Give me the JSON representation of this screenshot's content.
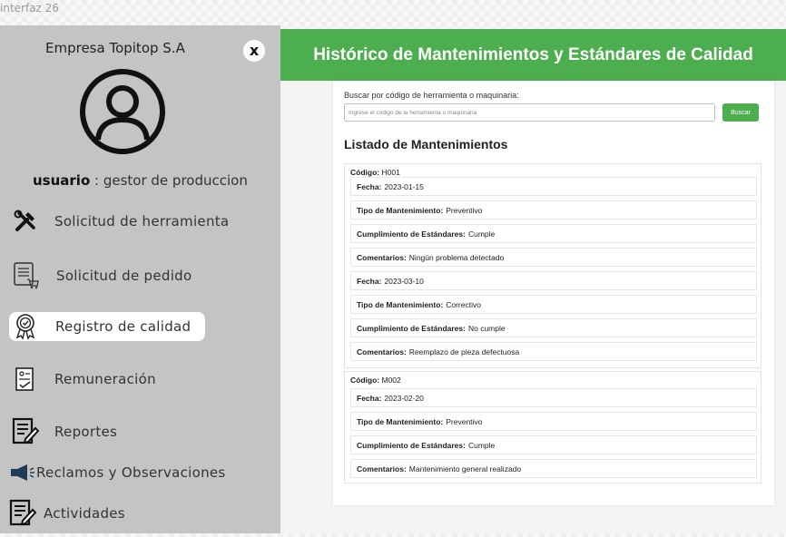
{
  "window": {
    "title": "interfaz 26"
  },
  "sidebar": {
    "company": "Empresa Topitop S.A",
    "close_label": "x",
    "user_label": "usuario",
    "user_role": " : gestor de produccion",
    "items": [
      {
        "label": "Solicitud de herramienta",
        "icon": "tools-icon"
      },
      {
        "label": "Solicitud de pedido",
        "icon": "order-list-cart-icon"
      },
      {
        "label": "Registro de calidad",
        "icon": "quality-badge-icon",
        "active": true
      },
      {
        "label": "Remuneración",
        "icon": "payroll-document-icon"
      },
      {
        "label": "Reportes",
        "icon": "report-edit-icon"
      },
      {
        "label": "Reclamos y Observaciones",
        "icon": "megaphone-icon"
      },
      {
        "label": "Actividades",
        "icon": "activities-edit-icon"
      }
    ]
  },
  "header": {
    "title": "Histórico de Mantenimientos y Estándares de Calidad"
  },
  "search": {
    "label": "Buscar por código de herramienta o maquinaria:",
    "placeholder": "Ingrese el código de la herramienta o maquinaria",
    "button": "Buscar"
  },
  "list": {
    "title": "Listado de Mantenimientos",
    "code_label": "Código:",
    "labels": {
      "fecha": "Fecha:",
      "tipo": "Tipo de Mantenimiento:",
      "cumplimiento": "Cumplimiento de Estándares:",
      "comentarios": "Comentarios:"
    },
    "groups": [
      {
        "code": "H001",
        "records": [
          {
            "fecha": "2023-01-15",
            "tipo": "Preventivo",
            "cumplimiento": "Cumple",
            "comentarios": "Ningún problema detectado"
          },
          {
            "fecha": "2023-03-10",
            "tipo": "Correctivo",
            "cumplimiento": "No cumple",
            "comentarios": "Reemplazo de pieza defectuosa"
          }
        ]
      },
      {
        "code": "M002",
        "records": [
          {
            "fecha": "2023-02-20",
            "tipo": "Preventivo",
            "cumplimiento": "Cumple",
            "comentarios": "Mantenimiento general realizado"
          }
        ]
      }
    ]
  },
  "colors": {
    "accent": "#4cae4f",
    "sidebar": "#c4c4c4"
  }
}
